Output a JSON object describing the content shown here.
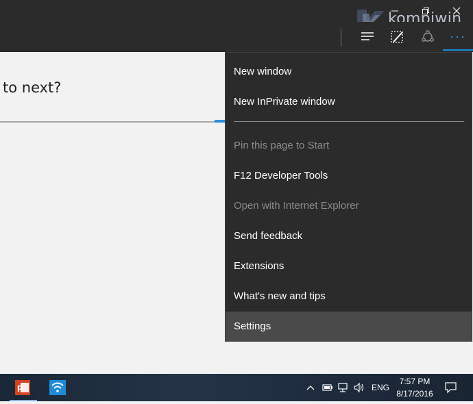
{
  "watermark": {
    "text": "kompiwin"
  },
  "content": {
    "question_text": "to next?"
  },
  "menu": {
    "items": [
      {
        "label": "New window",
        "enabled": true
      },
      {
        "label": "New InPrivate window",
        "enabled": true
      },
      {
        "label": "Pin this page to Start",
        "enabled": false
      },
      {
        "label": "F12 Developer Tools",
        "enabled": true
      },
      {
        "label": "Open with Internet Explorer",
        "enabled": false
      },
      {
        "label": "Send feedback",
        "enabled": true
      },
      {
        "label": "Extensions",
        "enabled": true
      },
      {
        "label": "What's new and tips",
        "enabled": true
      },
      {
        "label": "Settings",
        "enabled": true,
        "highlighted": true
      }
    ]
  },
  "taskbar": {
    "language": "ENG",
    "time": "7:57 PM",
    "date": "8/17/2016"
  },
  "colors": {
    "accent": "#1a8ce0",
    "menu_bg": "#2b2b2b",
    "menu_hover": "#4a4a4a",
    "disabled_text": "#8a8a8a"
  }
}
